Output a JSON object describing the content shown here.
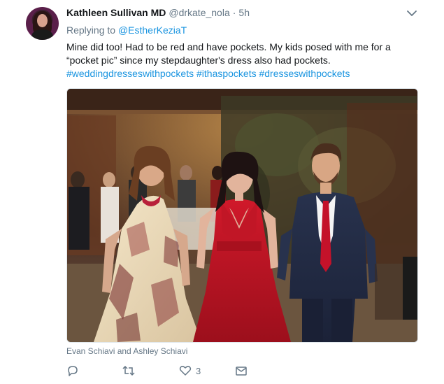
{
  "tweet": {
    "author_name": "Kathleen Sullivan MD",
    "author_handle": "@drkate_nola",
    "separator": "·",
    "timestamp": "5h",
    "replying_prefix": "Replying to",
    "replying_to": "@EstherKeziaT",
    "text_line1": "Mine did too! Had to be red and have pockets. My kids posed with me for a",
    "text_line2": "“pocket pic” since my stepdaughter's dress also had pockets.",
    "hashtags": "#weddingdresseswithpockets #ithaspockets #dresseswithpockets",
    "media_caption": "Evan Schiavi and Ashley Schiavi"
  },
  "actions": {
    "reply_icon": "reply-icon",
    "retweet_icon": "retweet-icon",
    "like_icon": "heart-icon",
    "like_count": "3",
    "dm_icon": "envelope-icon"
  },
  "colors": {
    "link": "#1b95e0",
    "muted": "#657786",
    "text": "#14171a"
  }
}
